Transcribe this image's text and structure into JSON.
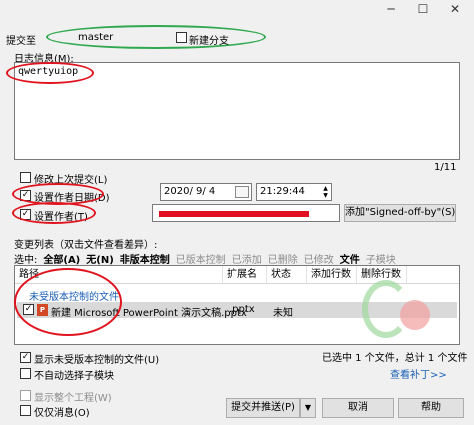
{
  "window": {
    "min_glyph": "─",
    "max_glyph": "☐",
    "close_glyph": "✕"
  },
  "commit_to": {
    "label": "提交至",
    "branch": "master",
    "new_branch_label": "新建分支"
  },
  "log": {
    "label": "日志信息(M):",
    "text": "qwertyuiop",
    "counter": "1/11"
  },
  "options": {
    "amend_label": "修改上次提交(L)",
    "set_date_label": "设置作者日期(D)",
    "set_date_checked": "✓",
    "date_value": "2020/  9/  4",
    "time_value": "21:29:44",
    "set_author_label": "设置作者(T)",
    "set_author_checked": "✓",
    "signed_off_button": "添加\"Signed-off-by\"(S)"
  },
  "changes": {
    "title": "变更列表（双击文件查看差异）:",
    "select_label": "选中:",
    "filters": [
      "全部(A)",
      "无(N)",
      "非版本控制",
      "已版本控制",
      "已添加",
      "已删除",
      "已修改",
      "文件",
      "子模块"
    ],
    "columns": [
      "路径",
      "扩展名",
      "状态",
      "添加行数",
      "删除行数"
    ],
    "group_label": "未受版本控制的文件",
    "row": {
      "checked": "✓",
      "name": "新建 Microsoft PowerPoint 演示文稿.pptx",
      "ext": ".pptx",
      "status": "未知"
    }
  },
  "bottom": {
    "show_unversioned": "显示未受版本控制的文件(U)",
    "show_unversioned_checked": "✓",
    "no_auto_submodule": "不自动选择子模块",
    "selected_info": "已选中 1 个文件，总计 1 个文件",
    "show_whole_project": "显示整个工程(W)",
    "message_only": "仅仅消息(O)",
    "view_patch": "查看补丁>>",
    "commit_push_button": "提交并推送(P)",
    "cancel_button": "取消",
    "help_button": "帮助"
  }
}
